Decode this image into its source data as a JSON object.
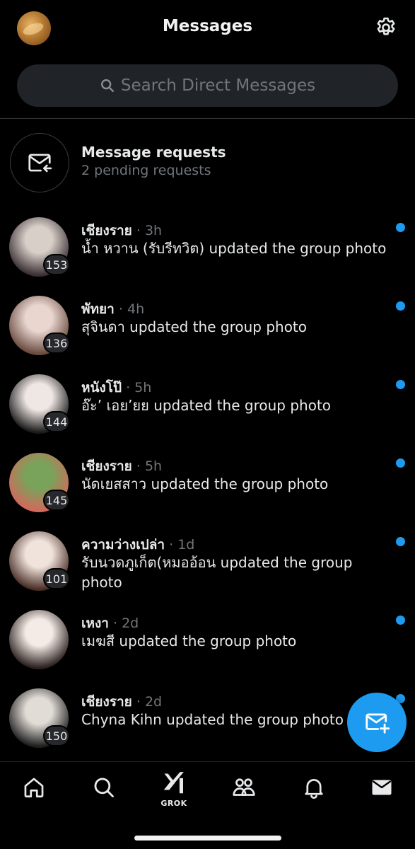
{
  "header": {
    "title": "Messages"
  },
  "search": {
    "placeholder": "Search Direct Messages"
  },
  "requests": {
    "title": "Message requests",
    "subtitle": "2 pending requests"
  },
  "conversations": [
    {
      "name": "เชียงราย",
      "time": "· 3h",
      "message": "น้ำ หวาน (รับรีทวิต) updated the group photo",
      "badge": "153",
      "unread": true,
      "avatar_colors": [
        "#d8cfc8",
        "#3a2f34"
      ]
    },
    {
      "name": "พัทยา",
      "time": "· 4h",
      "message": "สุจินดา updated the group photo",
      "badge": "136",
      "unread": true,
      "avatar_colors": [
        "#e8d6cf",
        "#6a4a3f"
      ]
    },
    {
      "name": "หนังโป๊",
      "time": "· 5h",
      "message": "อ๊ะ’ เอย’ยย updated the group photo",
      "badge": "144",
      "unread": true,
      "avatar_colors": [
        "#efe7e4",
        "#1a1a1a"
      ]
    },
    {
      "name": "เชียงราย",
      "time": "· 5h",
      "message": "นัดเยสสาว updated the group photo",
      "badge": "145",
      "unread": true,
      "avatar_colors": [
        "#79a35a",
        "#d3685c"
      ]
    },
    {
      "name": "ความว่างเปล่า",
      "time": "· 1d",
      "message": "รับนวดภูเก็ต(หมออ้อน updated the group photo",
      "badge": "101",
      "unread": true,
      "avatar_colors": [
        "#f0e3dc",
        "#4a2e26"
      ]
    },
    {
      "name": "เหงา",
      "time": "· 2d",
      "message": "เมฆสี updated the group photo",
      "badge": "",
      "unread": true,
      "avatar_colors": [
        "#f4ebe6",
        "#2b2120"
      ]
    },
    {
      "name": "เชียงราย",
      "time": "· 2d",
      "message": "Chyna Kihn updated the group photo",
      "badge": "150",
      "unread": true,
      "avatar_colors": [
        "#e2dcd6",
        "#1e1e1e"
      ]
    }
  ],
  "tabbar": {
    "grok_label": "GROK"
  },
  "colors": {
    "accent": "#1d9bf0",
    "background": "#000000",
    "muted": "#71767b"
  }
}
